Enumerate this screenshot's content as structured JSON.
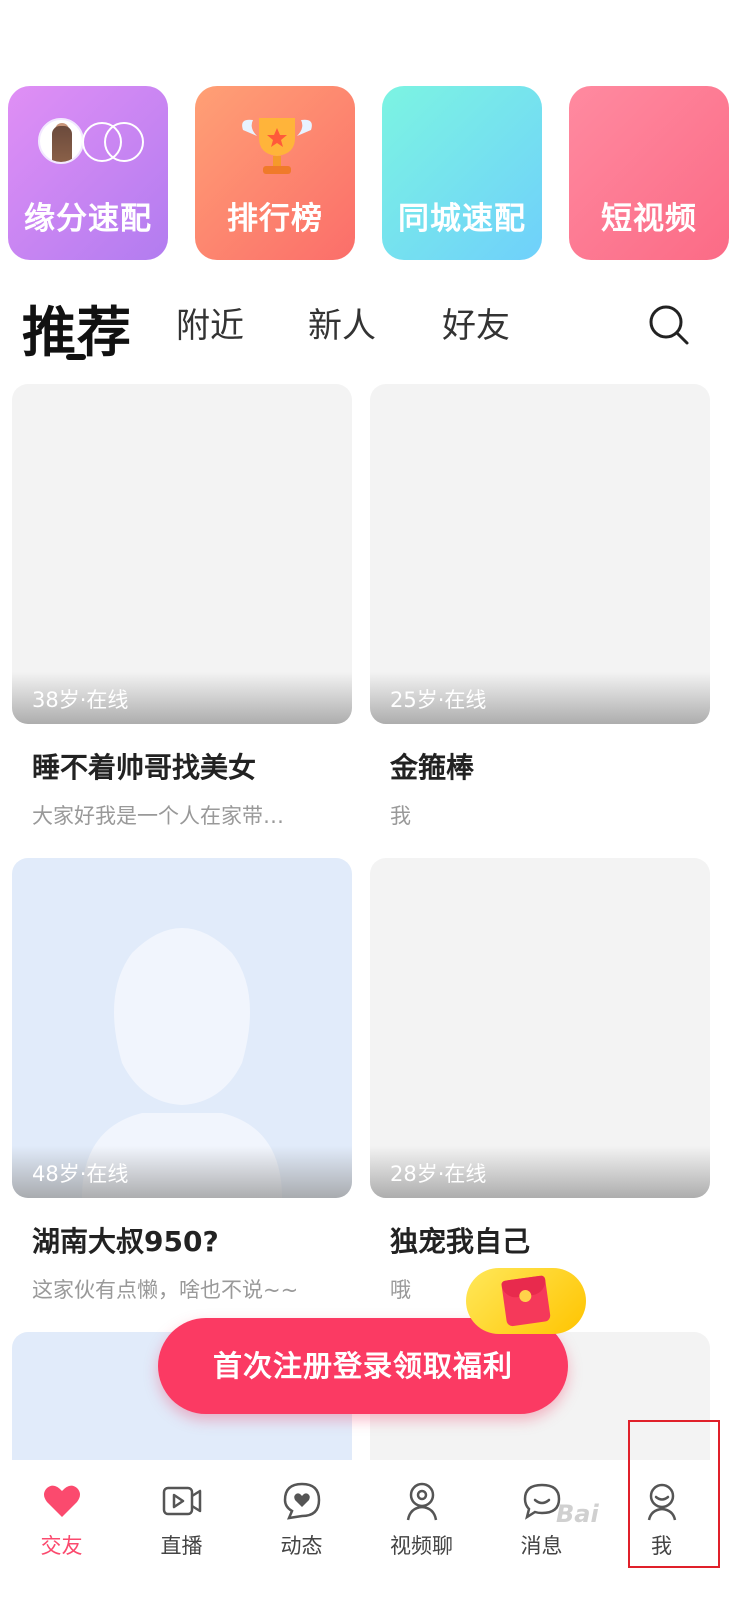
{
  "tiles": [
    {
      "label": "缘分速配",
      "icon": "match-avatar-rings-icon"
    },
    {
      "label": "排行榜",
      "icon": "trophy-icon"
    },
    {
      "label": "同城速配",
      "icon": ""
    },
    {
      "label": "短视频",
      "icon": ""
    }
  ],
  "tabs": {
    "recommend": "推荐",
    "nearby": "附近",
    "new": "新人",
    "friends": "好友",
    "search_icon": "search-icon"
  },
  "cards": [
    {
      "status": "38岁·在线",
      "name": "睡不着帅哥找美女",
      "bio": "大家好我是一个人在家带…"
    },
    {
      "status": "25岁·在线",
      "name": "金箍棒",
      "bio": "我"
    },
    {
      "status": "48岁·在线",
      "name": "湖南大叔950?",
      "bio": "这家伙有点懒，啥也不说~~"
    },
    {
      "status": "28岁·在线",
      "name": "独宠我自己",
      "bio": "哦"
    }
  ],
  "cta": {
    "label": "首次注册登录领取福利",
    "badge_icon": "red-envelope-icon"
  },
  "nav": [
    {
      "label": "交友",
      "icon": "heart-icon",
      "active": true
    },
    {
      "label": "直播",
      "icon": "video-icon",
      "active": false
    },
    {
      "label": "动态",
      "icon": "moments-icon",
      "active": false
    },
    {
      "label": "视频聊",
      "icon": "video-chat-icon",
      "active": false
    },
    {
      "label": "消息",
      "icon": "message-icon",
      "active": false
    },
    {
      "label": "我",
      "icon": "profile-icon",
      "active": false
    }
  ],
  "colors": {
    "accent": "#fb3a63",
    "nav_active": "#fb4a6e",
    "highlight_box": "#e0202a"
  },
  "watermark": "Bai"
}
